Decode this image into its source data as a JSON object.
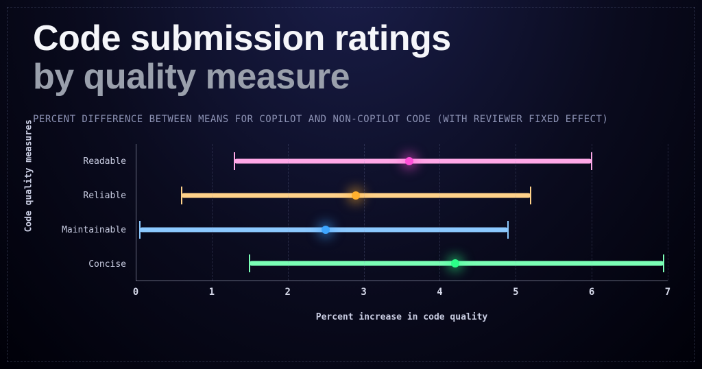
{
  "title_line1": "Code submission ratings",
  "title_line2": "by quality measure",
  "subtitle": "PERCENT DIFFERENCE BETWEEN MEANS FOR COPILOT AND NON-COPILOT CODE (WITH REVIEWER FIXED EFFECT)",
  "ylabel": "Code quality measures",
  "xlabel": "Percent increase in code quality",
  "chart_data": {
    "type": "bar",
    "orientation": "horizontal",
    "xlabel": "Percent increase in code quality",
    "ylabel": "Code quality measures",
    "xlim": [
      0,
      7
    ],
    "xticks": [
      0,
      1,
      2,
      3,
      4,
      5,
      6,
      7
    ],
    "categories": [
      "Readable",
      "Reliable",
      "Maintainable",
      "Concise"
    ],
    "series": [
      {
        "name": "Readable",
        "low": 1.3,
        "point": 3.6,
        "high": 6.0,
        "color": "#ff4fd8",
        "bar_color": "#ffa8e7"
      },
      {
        "name": "Reliable",
        "low": 0.6,
        "point": 2.9,
        "high": 5.2,
        "color": "#ffb02e",
        "bar_color": "#ffd28a"
      },
      {
        "name": "Maintainable",
        "low": 0.05,
        "point": 2.5,
        "high": 4.9,
        "color": "#3ea6ff",
        "bar_color": "#8cc9ff"
      },
      {
        "name": "Concise",
        "low": 1.5,
        "point": 4.2,
        "high": 6.95,
        "color": "#2bff88",
        "bar_color": "#7bffb6"
      }
    ]
  }
}
